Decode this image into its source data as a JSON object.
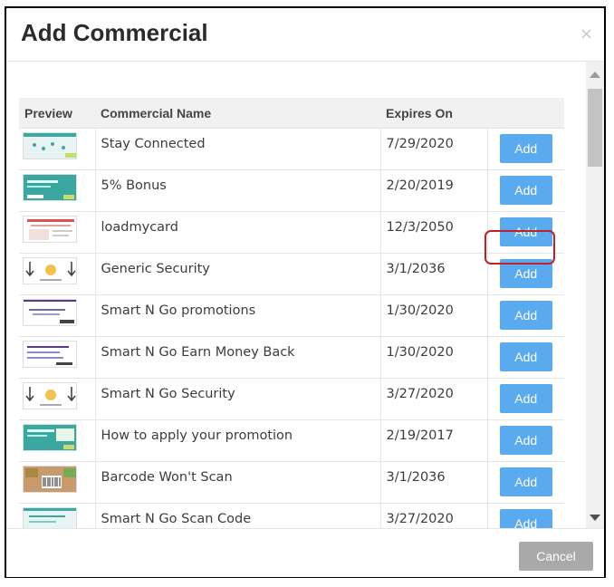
{
  "modal": {
    "title": "Add Commercial",
    "close_glyph": "×",
    "columns": [
      "Preview",
      "Commercial Name",
      "Expires On",
      ""
    ],
    "add_label": "Add",
    "cancel_label": "Cancel"
  },
  "rows": [
    {
      "name": "Stay Connected",
      "expires": "7/29/2020",
      "thumb": "teal-dots"
    },
    {
      "name": "5% Bonus",
      "expires": "2/20/2019",
      "thumb": "teal-banner",
      "highlighted": true
    },
    {
      "name": "loadmycard",
      "expires": "12/3/2050",
      "thumb": "red-doc"
    },
    {
      "name": "Generic Security",
      "expires": "3/1/2036",
      "thumb": "arrows-lock"
    },
    {
      "name": "Smart N Go promotions",
      "expires": "1/30/2020",
      "thumb": "purple-lines"
    },
    {
      "name": "Smart N Go Earn Money Back",
      "expires": "1/30/2020",
      "thumb": "purple-lines-2"
    },
    {
      "name": "Smart N Go Security",
      "expires": "3/27/2020",
      "thumb": "arrows-lock"
    },
    {
      "name": "How to apply your promotion",
      "expires": "2/19/2017",
      "thumb": "teal-banner-2"
    },
    {
      "name": "Barcode Won't Scan",
      "expires": "3/1/2036",
      "thumb": "barcode"
    },
    {
      "name": "Smart N Go Scan Code",
      "expires": "3/27/2020",
      "thumb": "teal-lines"
    }
  ],
  "colors": {
    "add_button": "#5aaaf0",
    "cancel_button": "#a9a9a9",
    "highlight_ring": "#c0202a"
  },
  "icons": {
    "close": "close-icon",
    "scroll_up": "scroll-up-arrow-icon",
    "scroll_down": "scroll-down-arrow-icon"
  }
}
